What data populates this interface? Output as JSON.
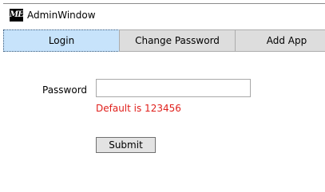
{
  "window": {
    "title": "AdminWindow",
    "icon_text": "ME"
  },
  "tabs": [
    {
      "label": "Login",
      "active": true
    },
    {
      "label": "Change Password",
      "active": false
    },
    {
      "label": "Add App",
      "active": false
    }
  ],
  "login": {
    "password_label": "Password",
    "password_value": "",
    "hint": "Default is 123456",
    "submit_label": "Submit"
  },
  "colors": {
    "active_tab": "#c7e3fb",
    "hint": "#e0201c"
  }
}
